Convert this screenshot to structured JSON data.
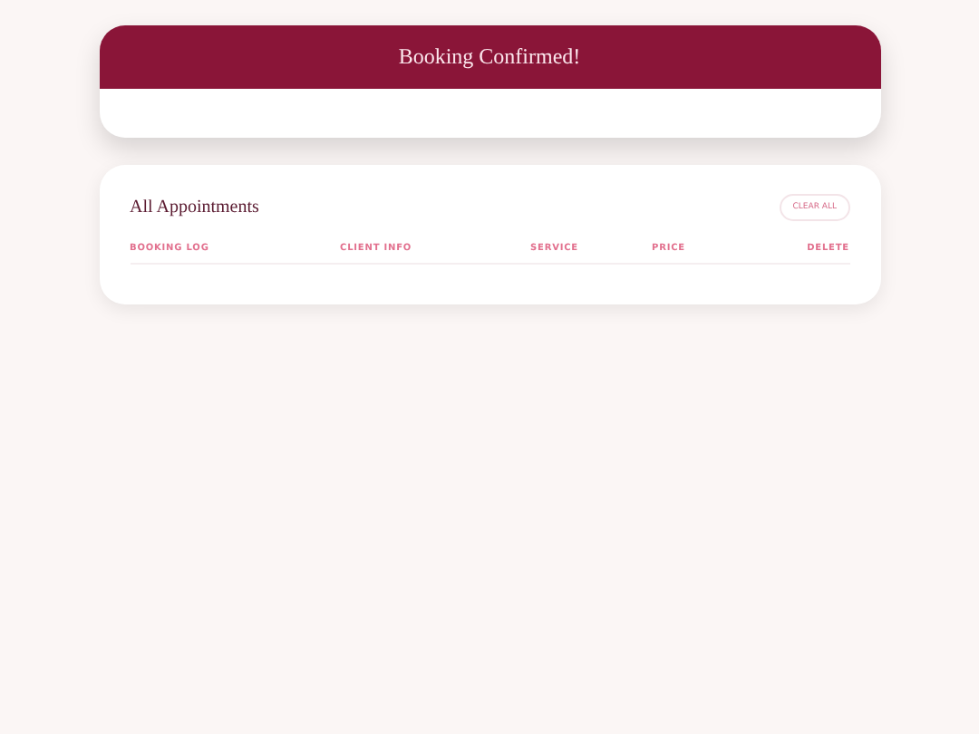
{
  "confirmation": {
    "title": "Booking Confirmed!"
  },
  "appointments": {
    "title": "All Appointments",
    "clear_button": "CLEAR ALL",
    "columns": [
      "BOOKING LOG",
      "CLIENT INFO",
      "SERVICE",
      "PRICE",
      "DELETE"
    ]
  }
}
